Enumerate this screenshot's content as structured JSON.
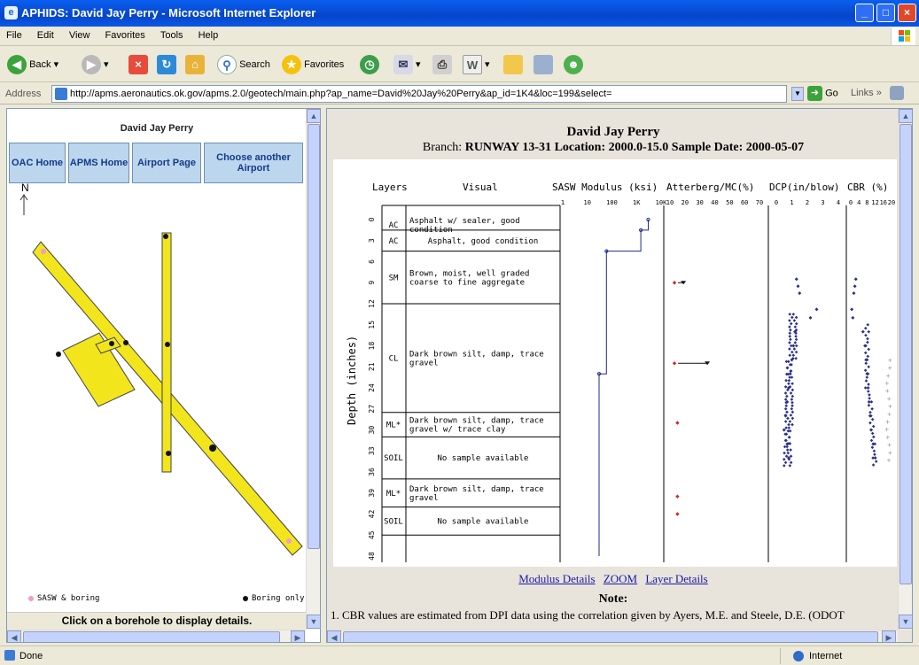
{
  "window": {
    "title": "APHIDS: David Jay Perry - Microsoft Internet Explorer"
  },
  "menu": [
    "File",
    "Edit",
    "View",
    "Favorites",
    "Tools",
    "Help"
  ],
  "toolbar": {
    "back": "Back",
    "search": "Search",
    "favorites": "Favorites"
  },
  "address": {
    "label": "Address",
    "url": "http://apms.aeronautics.ok.gov/apms.2.0/geotech/main.php?ap_name=David%20Jay%20Perry&ap_id=1K4&loc=199&select=",
    "go": "Go",
    "links": "Links"
  },
  "left": {
    "title": "David Jay Perry",
    "nav": [
      "OAC Home",
      "APMS Home",
      "Airport Page",
      "Choose another Airport"
    ],
    "north": "N",
    "legend_sasw": "SASW & boring",
    "legend_boring": "Boring only",
    "footer": "Click on a borehole to display details."
  },
  "right": {
    "title": "David Jay Perry",
    "sub_prefix": "Branch: ",
    "branch": "RUNWAY 13-31",
    "loc_label": "Location:",
    "location": "2000.0-15.0",
    "date_label": "Sample Date:",
    "date": "2000-05-07",
    "headers": {
      "layers": "Layers",
      "visual": "Visual",
      "sasw": "SASW Modulus (ksi)",
      "atterberg": "Atterberg/MC(%)",
      "dcp": "DCP(in/blow)",
      "cbr": "CBR (%)"
    },
    "sasw_ticks": [
      "1",
      "10",
      "100",
      "1K",
      "10K"
    ],
    "att_ticks": [
      "10",
      "20",
      "30",
      "40",
      "50",
      "60",
      "70"
    ],
    "dcp_ticks": [
      "0",
      "1",
      "2",
      "3",
      "4"
    ],
    "cbr_ticks": [
      "0",
      "4",
      "8",
      "12",
      "16",
      "20"
    ],
    "depth_label": "Depth (inches)",
    "depth_ticks": [
      "0",
      "3",
      "6",
      "9",
      "12",
      "15",
      "18",
      "21",
      "24",
      "27",
      "30",
      "33",
      "36",
      "39",
      "42",
      "45",
      "48"
    ],
    "layers": [
      {
        "code": "AC",
        "desc": "Asphalt w/ sealer, good condition",
        "top": 0,
        "bottom": 1.5
      },
      {
        "code": "AC",
        "desc": "Asphalt, good condition",
        "top": 1.5,
        "bottom": 4.5
      },
      {
        "code": "SM",
        "desc": "Brown, moist, well graded coarse to fine aggregate",
        "top": 4.5,
        "bottom": 12.0
      },
      {
        "code": "CL",
        "desc": "Dark brown silt, damp, trace gravel",
        "top": 12.0,
        "bottom": 27.5
      },
      {
        "code": "ML*",
        "desc": "Dark brown silt, damp, trace gravel w/ trace clay",
        "top": 27.5,
        "bottom": 31.0
      },
      {
        "code": "SOIL",
        "desc": "No sample available",
        "top": 31.0,
        "bottom": 37.0
      },
      {
        "code": "ML*",
        "desc": "Dark brown silt, damp, trace gravel",
        "top": 37.0,
        "bottom": 41.0
      },
      {
        "code": "SOIL",
        "desc": "No sample available",
        "top": 41.0,
        "bottom": 45.0
      }
    ],
    "links": [
      "Modulus Details",
      "ZOOM",
      "Layer Details"
    ],
    "note_title": "Note:",
    "note_text": "CBR values are estimated from DPI data using the correlation given by Ayers, M.E. and Steele, D.E. (ODOT"
  },
  "status": {
    "left": "Done",
    "right": "Internet"
  },
  "chart_data": {
    "type": "scatter",
    "title": "",
    "ylabel": "Depth (inches)",
    "ylim": [
      0,
      48
    ],
    "sasw_profile": {
      "depth": [
        0,
        1.5,
        1.5,
        4.5,
        4.5,
        22.0,
        22.0,
        48.0
      ],
      "modulus_ksi": [
        3000,
        3000,
        1500,
        1500,
        60,
        60,
        30,
        30
      ]
    },
    "atterberg_mc": {
      "depth": [
        9,
        20.5,
        29,
        39.5,
        42
      ],
      "mc": [
        13,
        13,
        15,
        15,
        15
      ]
    },
    "atterberg_ll": {
      "depth": [
        9,
        20.5
      ],
      "ll": [
        19,
        35
      ]
    },
    "dcp": [
      [
        1.3,
        8.5
      ],
      [
        1.4,
        9.5
      ],
      [
        1.5,
        10.5
      ],
      [
        2.6,
        12.8
      ],
      [
        2.2,
        14
      ],
      [
        1.2,
        16
      ],
      [
        1.1,
        18
      ],
      [
        1.0,
        20
      ],
      [
        0.9,
        22
      ],
      [
        0.8,
        24
      ],
      [
        0.7,
        26
      ],
      [
        0.6,
        28
      ],
      [
        0.5,
        30
      ],
      [
        0.7,
        32
      ],
      [
        0.8,
        34
      ]
    ],
    "cbr": [
      [
        2.5,
        8.5
      ],
      [
        2.0,
        9.5
      ],
      [
        1.5,
        10.5
      ],
      [
        0.5,
        12.8
      ],
      [
        1.0,
        14
      ],
      [
        6.0,
        16
      ],
      [
        7.0,
        18
      ],
      [
        7.5,
        20
      ],
      [
        8.0,
        22
      ],
      [
        8.5,
        24
      ],
      [
        9.0,
        26
      ],
      [
        9.5,
        28
      ],
      [
        10.0,
        30
      ],
      [
        11.0,
        32
      ],
      [
        12.0,
        34
      ]
    ]
  }
}
